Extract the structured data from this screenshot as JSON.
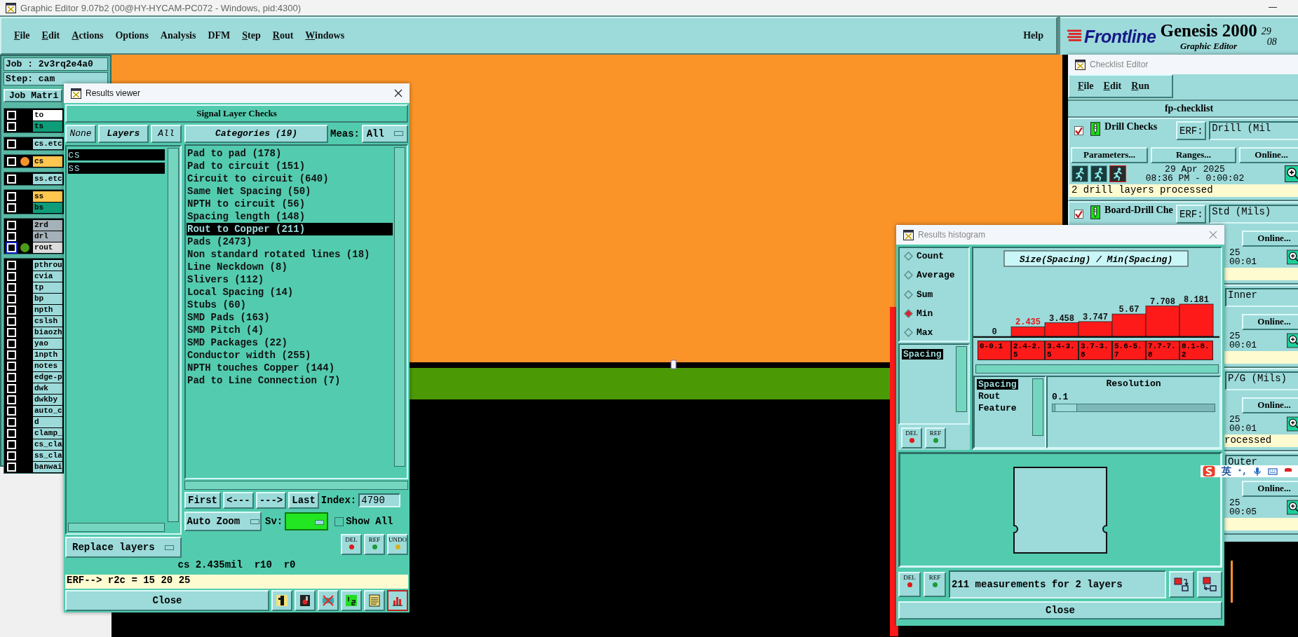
{
  "window": {
    "title": "Graphic Editor 9.07b2 (00@HY-HYCAM-PC072 - Windows, pid:4300)"
  },
  "menu": [
    {
      "label": "File",
      "underlined": true
    },
    {
      "label": "Edit",
      "underlined": true
    },
    {
      "label": "Actions",
      "underlined": true
    },
    {
      "label": "Options",
      "underlined": false
    },
    {
      "label": "Analysis",
      "underlined": false
    },
    {
      "label": "DFM",
      "underlined": false
    },
    {
      "label": "Step",
      "underlined": true
    },
    {
      "label": "Rout",
      "underlined": true
    },
    {
      "label": "Windows",
      "underlined": true
    }
  ],
  "help": "Help",
  "brand": {
    "logo": "Frontline",
    "product": "Genesis 2000",
    "subtitle": "Graphic Editor",
    "date_fragment": "29",
    "time_fragment": "08"
  },
  "job": {
    "job": "Job : 2v3rq2e4a0",
    "step": "Step: cam",
    "matrix_button": "Job Matri"
  },
  "layer_groups": [
    {
      "layers": [
        {
          "name": "to",
          "color": "#ffffff",
          "checked": false
        },
        {
          "name": "ts",
          "color": "#0e9c79",
          "checked": false
        }
      ]
    },
    {
      "layers": [
        {
          "name": "cs.etc",
          "color": "#9ddada",
          "checked": false
        }
      ]
    },
    {
      "layers": [
        {
          "name": "cs",
          "color": "#ffc650",
          "checked": false,
          "marker": {
            "color": "#f7922a"
          }
        }
      ]
    },
    {
      "layers": [
        {
          "name": "ss.etc",
          "color": "#9ddada",
          "checked": false
        }
      ]
    },
    {
      "layers": [
        {
          "name": "ss",
          "color": "#ffc650",
          "checked": false
        },
        {
          "name": "bs",
          "color": "#0e9c79",
          "checked": false
        }
      ]
    },
    {
      "layers": [
        {
          "name": "2rd",
          "color": "#a5b1b9",
          "checked": false
        },
        {
          "name": "drl",
          "color": "#a5b1b9",
          "checked": false
        },
        {
          "name": "rout",
          "color": "#dcdcdc",
          "checked": false,
          "active": true,
          "marker": {
            "color": "#4c9a1a"
          }
        }
      ]
    },
    {
      "layers": [
        {
          "name": "pthrou",
          "color": "#9ddada",
          "checked": false
        },
        {
          "name": "cvia",
          "color": "#9ddada",
          "checked": false
        },
        {
          "name": "tp",
          "color": "#9ddada",
          "checked": false
        },
        {
          "name": "bp",
          "color": "#9ddada",
          "checked": false
        },
        {
          "name": "npth",
          "color": "#9ddada",
          "checked": false
        },
        {
          "name": "cslsh",
          "color": "#9ddada",
          "checked": false
        },
        {
          "name": "biaozh",
          "color": "#9ddada",
          "checked": false
        },
        {
          "name": "yao",
          "color": "#9ddada",
          "checked": false
        },
        {
          "name": "1npth",
          "color": "#9ddada",
          "checked": false
        },
        {
          "name": "notes",
          "color": "#9ddada",
          "checked": false
        },
        {
          "name": "edge-p",
          "color": "#9ddada",
          "checked": false
        },
        {
          "name": "dwk",
          "color": "#9ddada",
          "checked": false
        },
        {
          "name": "dwkby",
          "color": "#9ddada",
          "checked": false
        },
        {
          "name": "auto_c",
          "color": "#9ddada",
          "checked": false
        },
        {
          "name": "d",
          "color": "#9ddada",
          "checked": false
        },
        {
          "name": "clamp_",
          "color": "#9ddada",
          "checked": false
        },
        {
          "name": "cs_cla",
          "color": "#9ddada",
          "checked": false
        },
        {
          "name": "ss_cla",
          "color": "#9ddada",
          "checked": false
        },
        {
          "name": "banwai",
          "color": "#9ddada",
          "checked": false
        }
      ]
    }
  ],
  "results_viewer": {
    "title": "Results viewer",
    "heading": "Signal Layer Checks",
    "none_button": "None",
    "layers_label": "Layers",
    "all_button": "All",
    "layers": [
      {
        "name": "cs",
        "selected": true
      },
      {
        "name": "ss",
        "selected": true
      }
    ],
    "replace": "Replace layers",
    "categories_button": "Categories (19)",
    "meas_label": "Meas:",
    "meas_value": "All",
    "categories": [
      {
        "label": "Pad to pad (178)",
        "selected": false
      },
      {
        "label": "Pad to circuit (151)",
        "selected": false
      },
      {
        "label": "Circuit to circuit (640)",
        "selected": false
      },
      {
        "label": "Same Net Spacing (50)",
        "selected": false
      },
      {
        "label": "NPTH to circuit (56)",
        "selected": false
      },
      {
        "label": "Spacing length (148)",
        "selected": false
      },
      {
        "label": "Rout to Copper (211)",
        "selected": true
      },
      {
        "label": "Pads (2473)",
        "selected": false
      },
      {
        "label": "Non standard rotated lines (18)",
        "selected": false
      },
      {
        "label": "Line Neckdown (8)",
        "selected": false
      },
      {
        "label": "Slivers (112)",
        "selected": false
      },
      {
        "label": "Local Spacing (14)",
        "selected": false
      },
      {
        "label": "Stubs (60)",
        "selected": false
      },
      {
        "label": "SMD Pads (163)",
        "selected": false
      },
      {
        "label": "SMD Pitch (4)",
        "selected": false
      },
      {
        "label": "SMD Packages (22)",
        "selected": false
      },
      {
        "label": "Conductor width (255)",
        "selected": false
      },
      {
        "label": "NPTH touches Copper (144)",
        "selected": false
      },
      {
        "label": "Pad to Line Connection (7)",
        "selected": false
      }
    ],
    "nav": [
      "First",
      "<---",
      "--->",
      "Last"
    ],
    "index_label": "Index:",
    "index_value": "4790",
    "zoom_mode": "Auto Zoom",
    "sv_label": "Sv:",
    "show_all": {
      "label": "Show All",
      "checked": false
    },
    "tools": [
      "DEL",
      "REF",
      "UNDO"
    ],
    "status": "cs 2.435mil  r10  r0",
    "erf": "ERF--> r2c = 15 20 25",
    "close": "Close"
  },
  "histogram": {
    "title": "Results histogram",
    "modes": [
      {
        "label": "Count",
        "selected": false
      },
      {
        "label": "Average",
        "selected": false
      },
      {
        "label": "Sum",
        "selected": false
      },
      {
        "label": "Min",
        "selected": true
      },
      {
        "label": "Max",
        "selected": false
      }
    ],
    "attributes": [
      {
        "label": "Spacing",
        "selected": true
      }
    ],
    "tools": [
      "DEL",
      "REF"
    ],
    "chart_data": {
      "type": "bar",
      "title": "Size(Spacing) / Min(Spacing)",
      "categories": [
        "0-0.1",
        "2.4-2.5",
        "3.4-3.5",
        "3.7-3.8",
        "5.6-5.7",
        "7.7-7.8",
        "8.1-8.2"
      ],
      "values": [
        0,
        2.435,
        3.458,
        3.747,
        5.67,
        7.708,
        8.181
      ],
      "data_labels": true
    },
    "bins": [
      {
        "selected": false
      },
      {
        "selected": true
      },
      {
        "selected": false
      },
      {
        "selected": false
      },
      {
        "selected": false
      },
      {
        "selected": false
      },
      {
        "selected": false
      }
    ],
    "fields": [
      {
        "label": "Spacing",
        "selected": true
      },
      {
        "label": "Rout",
        "selected": false
      },
      {
        "label": "Feature",
        "selected": false
      }
    ],
    "resolution_label": "Resolution",
    "resolution_value": "0.1",
    "resolution": {
      "level": 0.08
    },
    "bottom_tools": [
      "DEL",
      "REF"
    ],
    "summary": "211 measurements for 2 layers",
    "close": "Close"
  },
  "checklist": {
    "title": "Checklist Editor",
    "menu": [
      "File",
      "Edit",
      "Run"
    ],
    "name": "fp-checklist",
    "items": [
      {
        "kind": "full",
        "checked": true,
        "title": "Drill Checks",
        "erf_button": "ERF:",
        "erf_value": "Drill (Mil",
        "buttons": [
          "Parameters...",
          "Ranges...",
          "Online..."
        ],
        "date": "29 Apr 2025",
        "time": "08:36 PM - 0:00:02",
        "message": "2 drill layers processed"
      },
      {
        "kind": "partial",
        "checked": true,
        "title": "Board-Drill Che",
        "erf_button": "ERF:",
        "erf_value": "Std (Mils)",
        "buttons": [
          "Online..."
        ],
        "date": "25",
        "time": "00:01"
      },
      {
        "kind": "covered",
        "erf_value": "Inner",
        "buttons": [
          "Online..."
        ],
        "date": "25",
        "time": "00:01"
      },
      {
        "kind": "covered",
        "erf_value": "P/G (Mils)",
        "buttons": [
          "Online..."
        ],
        "date": "25",
        "time": "00:01",
        "message": "rocessed"
      },
      {
        "kind": "covered",
        "erf_value": "Outer",
        "buttons": [
          "Online..."
        ],
        "date": "25",
        "time": "00:05"
      }
    ]
  },
  "ime": {
    "language": "英"
  }
}
